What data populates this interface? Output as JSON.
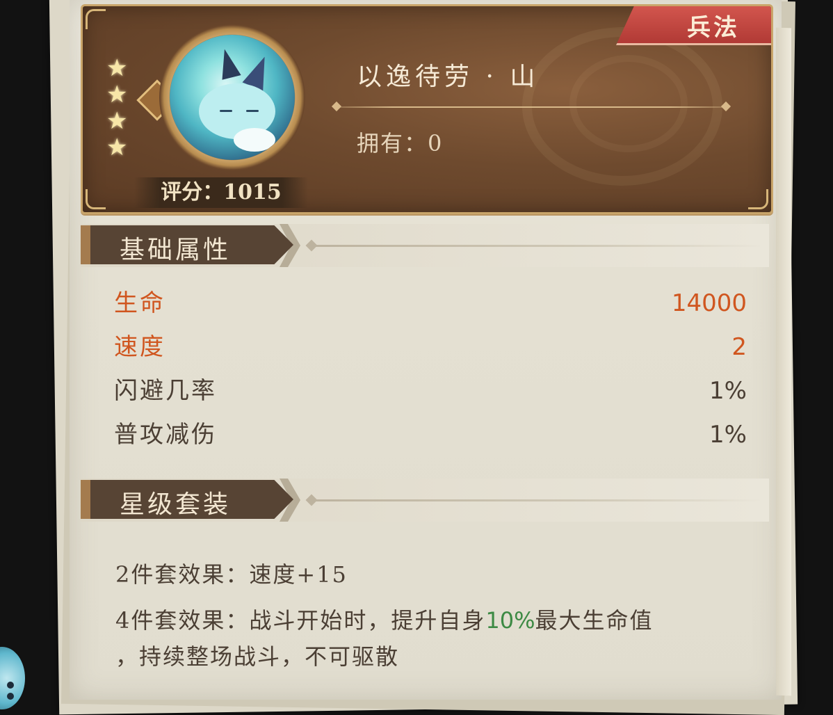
{
  "tab": "兵法",
  "item": {
    "stars": 4,
    "name": "以逸待劳 · 山",
    "owned_label": "拥有：",
    "owned_value": "0",
    "score_label": "评分：",
    "score_value": "1015"
  },
  "base_section": {
    "title": "基础属性",
    "stats": [
      {
        "label": "生命",
        "value": "14000"
      },
      {
        "label": "速度",
        "value": "2"
      },
      {
        "label": "闪避几率",
        "value": "1%"
      },
      {
        "label": "普攻减伤",
        "value": "1%"
      }
    ]
  },
  "set_section": {
    "title": "星级套装",
    "effect2_label": "2件套效果：",
    "effect2_text": "速度+15",
    "effect4_label": "4件套效果：",
    "effect4_text_a": "战斗开始时，提升自身",
    "effect4_highlight": "10%",
    "effect4_text_b": "最大生命值",
    "effect4_text_c": "，持续整场战斗，不可驱散"
  },
  "colors": {
    "highlight_stat": "#d0561f",
    "normal_text": "#4b3f34",
    "effect_highlight": "#3d8a44",
    "tab_red": "#b13a35",
    "header_brown": "#6e4a2e"
  }
}
